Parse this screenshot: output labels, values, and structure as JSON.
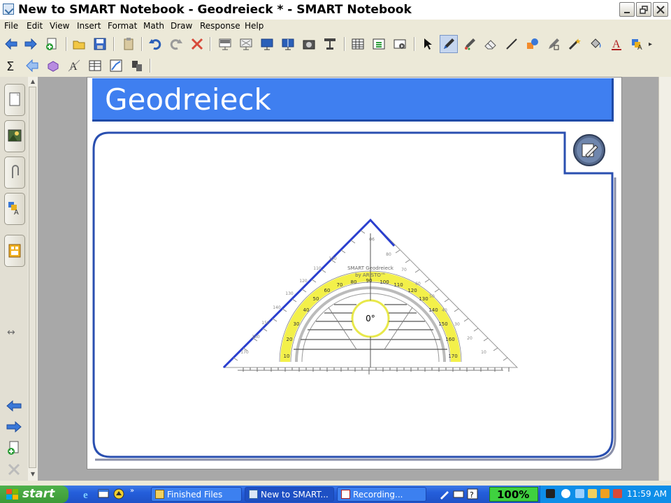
{
  "window": {
    "title": "New to SMART Notebook - Geodreieck * - SMART Notebook"
  },
  "menu": [
    "File",
    "Edit",
    "View",
    "Insert",
    "Format",
    "Math",
    "Draw",
    "Response",
    "Help"
  ],
  "toolbar": {
    "row1_icons": [
      "back-icon",
      "forward-icon",
      "add-page-icon",
      "open-icon",
      "save-icon",
      "paste-icon",
      "undo-icon",
      "redo-icon",
      "delete-icon",
      "show-screen-shade-icon",
      "full-screen-icon",
      "dual-display-icon",
      "screen-capture-icon",
      "document-camera-icon",
      "table-icon",
      "insert-icon",
      "record-icon",
      "select-icon",
      "pen-icon",
      "creative-pen-icon",
      "eraser-icon",
      "line-icon",
      "shape-icon",
      "magic-pen-icon",
      "shape-recognition-icon",
      "fill-icon",
      "text-icon",
      "properties-icon"
    ],
    "row2_icons": [
      "math-sum-icon",
      "arrow-tools-icon",
      "3d-tools-icon",
      "text-tools-icon",
      "table-tools-icon",
      "graph-tools-icon",
      "extra-tools-icon"
    ]
  },
  "sidebar": {
    "tabs": [
      "page-sorter-icon",
      "gallery-icon",
      "attachments-icon",
      "properties-icon",
      "addons-icon"
    ]
  },
  "slide": {
    "title": "Geodreieck",
    "ruler": {
      "center_label": "0°",
      "brand_line1": "SMART Geodreieck",
      "brand_line2": "by ARISTO™",
      "top_label": "90",
      "outer_scale": [
        "10",
        "20",
        "30",
        "40",
        "50",
        "60",
        "70",
        "80",
        "100",
        "110",
        "120",
        "130",
        "140",
        "150",
        "160",
        "170"
      ],
      "yellow_scale": [
        "10",
        "20",
        "30",
        "40",
        "50",
        "60",
        "70",
        "80",
        "90",
        "100",
        "110",
        "120",
        "130",
        "140",
        "150",
        "160",
        "170"
      ]
    }
  },
  "taskbar": {
    "start_label": "start",
    "tasks": [
      {
        "label": "Finished Files"
      },
      {
        "label": "New to SMART..."
      },
      {
        "label": "Recording..."
      }
    ],
    "zoom": "100%",
    "clock": "11:59 AM"
  },
  "colors": {
    "accent": "#3f7ff0",
    "header_border": "#1e4aa8",
    "ruler_yellow": "#f3f04a",
    "page_bg": "#ffffff",
    "work_bg": "#a8a8a8"
  }
}
